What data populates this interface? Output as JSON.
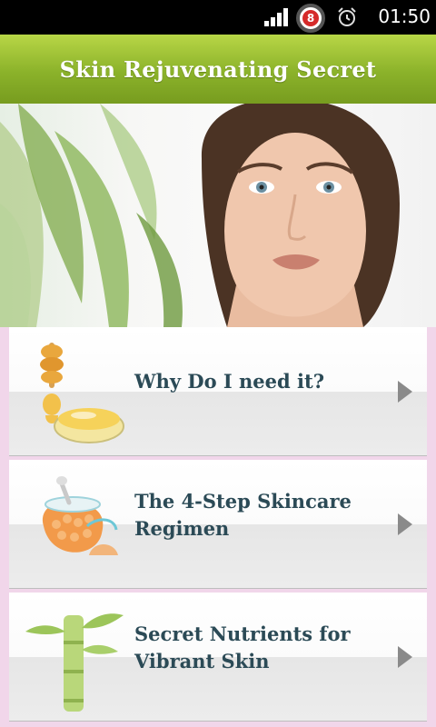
{
  "status_bar": {
    "time": "01:50",
    "notification_count": "8",
    "icons": [
      "signal-icon",
      "notification-badge-icon",
      "alarm-clock-icon"
    ]
  },
  "header": {
    "title": "Skin Rejuvenating Secret"
  },
  "banner": {
    "image": "woman-face-with-aloe-leaves"
  },
  "menu": [
    {
      "label": "Why Do I need it?",
      "icon": "honey-dipper-icon"
    },
    {
      "label": "The 4-Step Skincare Regimen",
      "icon": "scrub-jar-icon"
    },
    {
      "label": "Secret Nutrients for Vibrant Skin",
      "icon": "bamboo-icon"
    }
  ],
  "colors": {
    "header_green": "#8bb22a",
    "label_text": "#2b4a56",
    "background_pink": "#f1d6ea"
  }
}
